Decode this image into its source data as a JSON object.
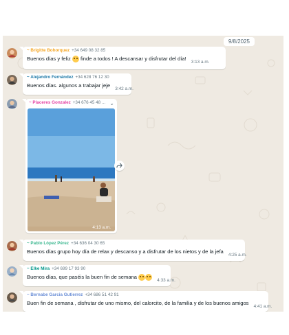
{
  "date_chip": "9/8/2025",
  "colors": {
    "chat_bg": "#efeae2",
    "bubble_bg": "#ffffff",
    "sky": "#7cb8e6",
    "sea": "#2d78c0",
    "sand": "#d7c1a3"
  },
  "messages": [
    {
      "name": "~ Brigitte Bohorquez",
      "name_color": "#f5a623",
      "phone": "+34 649 08 32 85",
      "text_before": "Buenos días y feliz",
      "emoji": "kissing-face-emoji",
      "text_after": "finde a todos ! A descansar y disfrutar del día!",
      "time": "3:13 a.m."
    },
    {
      "name": "~ Alejandro Fernández",
      "name_color": "#1f7aa8",
      "phone": "+34 628 76 12 30",
      "text": "Buenos días. algunos a trabajar jeje",
      "time": "3:42 a.m."
    },
    {
      "name": "~ Placeres Gonzalez",
      "name_color": "#e542a3",
      "phone": "+34 676 45 48 ...",
      "image": "beach-photo",
      "time": "4:13 a.m."
    },
    {
      "name": "~ Pablo López Pérez",
      "name_color": "#3bb78f",
      "phone": "+34 636 04 30 65",
      "text": "Buenos días grupo hoy día de relax y descanso y a disfrutar de los nietos y de la jefa",
      "time": "4:25 a.m."
    },
    {
      "name": "~ Elke Mira",
      "name_color": "#009688",
      "phone": "+34 699 17 93 90",
      "text": "Buenos días, que paséis la buen fin de semana",
      "emoji": "kissing-face-emoji",
      "time": "4:33 a.m."
    },
    {
      "name": "~ Bernabe Garcia Gutierrez",
      "name_color": "#6b8fd6",
      "phone": "+34 686 51 42 91",
      "text": "Buen fin de semana , disfrutar de uno mismo, del calorcito, de la familia y de los buenos amigos",
      "time": "4:41 a.m."
    }
  ]
}
